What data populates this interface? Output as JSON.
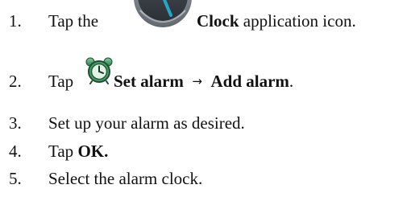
{
  "colors": {
    "text": "#111111",
    "clock_icon_rim": "#6f7680",
    "clock_icon_hand": "#25a6c9",
    "alarm_icon_green": "#4a9e6a"
  },
  "icons": {
    "clock_app": "clock-app-icon",
    "alarm": "alarm-clock-icon",
    "arrow": "right-arrow"
  },
  "steps": [
    {
      "number": "1.",
      "prefix": "Tap the",
      "bold": "Clock",
      "suffix": " application icon."
    },
    {
      "number": "2.",
      "prefix": "Tap",
      "bold_a": "Set alarm",
      "arrow": "→",
      "bold_b": "Add alarm",
      "suffix": "."
    },
    {
      "number": "3.",
      "text": "Set up your alarm as desired."
    },
    {
      "number": "4.",
      "prefix": "Tap ",
      "bold": "OK."
    },
    {
      "number": "5.",
      "text": "Select the alarm clock."
    }
  ]
}
